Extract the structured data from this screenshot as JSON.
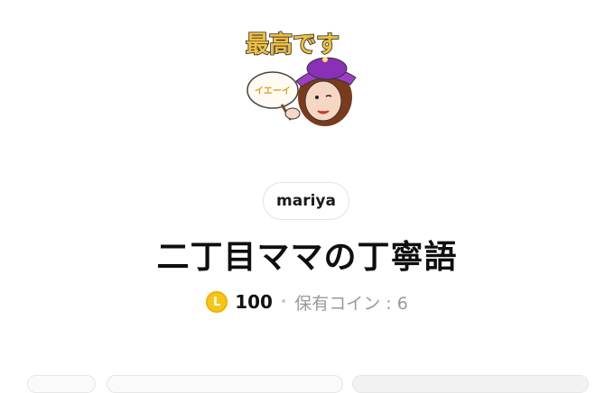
{
  "sticker": {
    "caption": "最高です",
    "fan_text": "イエーイ",
    "colors": {
      "caption_fill": "#f0c040",
      "caption_stroke": "#2a2a2a",
      "hat": "#9b3fc9",
      "hair": "#7a3b1c",
      "skin": "#f6d7c3"
    }
  },
  "creator": {
    "name": "mariya"
  },
  "title": "二丁目ママの丁寧語",
  "price": {
    "coin_icon_letter": "L",
    "amount": "100",
    "separator": "•",
    "owned_coins": "保有コイン : 6"
  },
  "colors": {
    "coin": "#f5c518",
    "muted_text": "#9a9a9a"
  }
}
